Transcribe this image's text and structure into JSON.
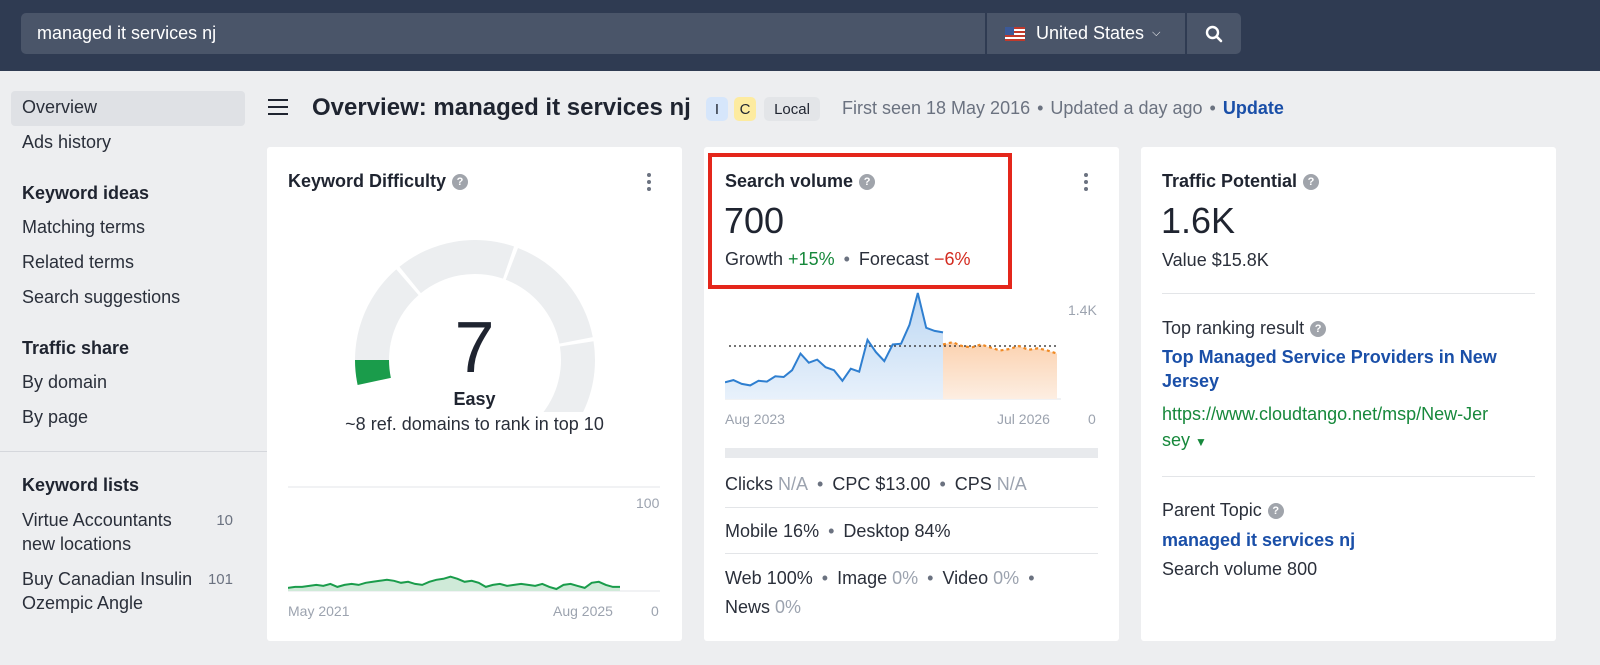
{
  "search": {
    "query": "managed it services nj",
    "country": "United States"
  },
  "sidebar": {
    "overview": "Overview",
    "ads_history": "Ads history",
    "keyword_ideas_heading": "Keyword ideas",
    "matching_terms": "Matching terms",
    "related_terms": "Related terms",
    "search_suggestions": "Search suggestions",
    "traffic_share_heading": "Traffic share",
    "by_domain": "By domain",
    "by_page": "By page",
    "keyword_lists_heading": "Keyword lists",
    "lists": [
      {
        "name": "Virtue Accountants new locations",
        "count": "10"
      },
      {
        "name": "Buy Canadian Insulin Ozempic Angle",
        "count": "101"
      }
    ]
  },
  "header": {
    "title": "Overview: managed it services nj",
    "badges": [
      "I",
      "C",
      "Local"
    ],
    "first_seen": "First seen 18 May 2016",
    "updated": "Updated a day ago",
    "update_link": "Update"
  },
  "kd_card": {
    "title": "Keyword Difficulty",
    "score": "7",
    "rating": "Easy",
    "subtext": "~8 ref. domains to rank in top 10",
    "gauge_fraction": 0.07,
    "colors": {
      "fill": "#1a9c4b",
      "track": "#eceef0"
    },
    "chart": {
      "x_start": "May 2021",
      "x_end": "Aug 2025",
      "y_max_label": "100",
      "y_min_label": "0",
      "values": [
        3,
        4,
        4,
        5,
        6,
        5,
        7,
        4,
        6,
        7,
        6,
        8,
        9,
        10,
        11,
        10,
        8,
        9,
        7,
        6,
        9,
        11,
        12,
        14,
        12,
        9,
        10,
        8,
        4,
        6,
        7,
        5,
        6,
        7,
        6,
        5,
        7,
        4,
        2,
        6,
        7,
        5,
        3,
        8,
        9,
        6,
        4,
        4
      ]
    }
  },
  "sv_card": {
    "title": "Search volume",
    "value": "700",
    "growth_label": "Growth",
    "growth_value": "+15%",
    "forecast_label": "Forecast",
    "forecast_value": "−6%",
    "chart": {
      "x_start": "Aug 2023",
      "x_end": "Jul 2026",
      "y_max_label": "1.4K",
      "y_min_label": "0",
      "y_max": 1400,
      "avg_line": 700,
      "history": [
        220,
        250,
        200,
        180,
        240,
        230,
        300,
        290,
        380,
        600,
        480,
        520,
        420,
        380,
        240,
        400,
        360,
        780,
        620,
        500,
        720,
        730,
        980,
        1400,
        940,
        900,
        880
      ],
      "forecast": [
        720,
        750,
        700,
        680,
        720,
        680,
        640,
        660,
        700,
        650,
        670,
        640,
        600
      ]
    },
    "clicks_label": "Clicks",
    "clicks_value": "N/A",
    "cpc_label": "CPC",
    "cpc_value": "$13.00",
    "cps_label": "CPS",
    "cps_value": "N/A",
    "mobile_label": "Mobile",
    "mobile_value": "16%",
    "desktop_label": "Desktop",
    "desktop_value": "84%",
    "web_label": "Web",
    "web_value": "100%",
    "image_label": "Image",
    "image_value": "0%",
    "video_label": "Video",
    "video_value": "0%",
    "news_label": "News",
    "news_value": "0%"
  },
  "tp_card": {
    "title": "Traffic Potential",
    "value": "1.6K",
    "value_text": "Value $15.8K",
    "top_ranking_label": "Top ranking result",
    "top_result_title_1": "Top Managed Service Providers in New",
    "top_result_title_2": "Jersey",
    "top_result_url_1": "https://www.cloudtango.net/msp/New-Jer",
    "top_result_url_2": "sey",
    "parent_topic_label": "Parent Topic",
    "parent_topic_link": "managed it services nj",
    "parent_search_volume": "Search volume 800"
  },
  "colors": {
    "topbar": "#2f3b52",
    "link": "#1a4fa8",
    "positive": "#16883b",
    "negative": "#d32a1f",
    "highlight": "#e4261b",
    "badge_i": "#d6e6fb",
    "badge_c": "#fdeba0",
    "badge_local": "#e3e5e8"
  }
}
